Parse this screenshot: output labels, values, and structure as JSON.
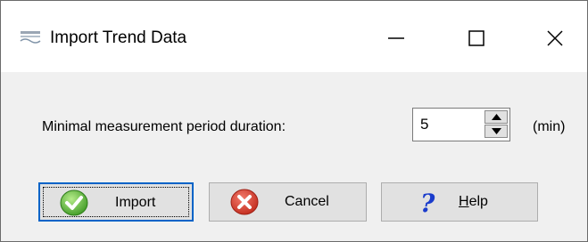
{
  "window": {
    "title": "Import Trend Data",
    "app_icon": "sentec-logo",
    "controls": [
      "minimize-icon",
      "maximize-icon",
      "close-icon"
    ]
  },
  "form": {
    "period_label": "Minimal measurement period duration:",
    "period_value": "5",
    "period_unit": "(min)"
  },
  "buttons": {
    "import_label": "Import",
    "cancel_label": "Cancel",
    "help_label": "Help",
    "import_icon": "green-check-icon",
    "cancel_icon": "red-x-icon",
    "help_icon": "blue-question-icon"
  },
  "colors": {
    "focus_border": "#0063c7",
    "check_green": "#5db53e",
    "cancel_red": "#d93a2b",
    "help_blue": "#1a3ccc"
  }
}
